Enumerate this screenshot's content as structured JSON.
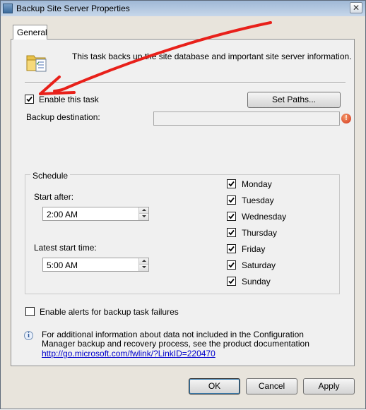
{
  "window": {
    "title": "Backup Site Server Properties",
    "close_glyph": "✕"
  },
  "tabs": [
    {
      "label": "General",
      "selected": true
    }
  ],
  "header": {
    "description": "This task backs up the site database and important site server information.",
    "icon": "folder-task-icon"
  },
  "enable_task": {
    "label": "Enable this task",
    "checked": true
  },
  "set_paths_button": {
    "label": "Set Paths..."
  },
  "backup_destination": {
    "label": "Backup destination:",
    "value": "",
    "error_icon": "error-icon",
    "error_glyph": "!"
  },
  "schedule": {
    "title": "Schedule",
    "start_after": {
      "label": "Start after:",
      "value": "2:00 AM"
    },
    "latest_start": {
      "label": "Latest start time:",
      "value": "5:00 AM"
    },
    "days": [
      {
        "label": "Monday",
        "checked": true
      },
      {
        "label": "Tuesday",
        "checked": true
      },
      {
        "label": "Wednesday",
        "checked": true
      },
      {
        "label": "Thursday",
        "checked": true
      },
      {
        "label": "Friday",
        "checked": true
      },
      {
        "label": "Saturday",
        "checked": true
      },
      {
        "label": "Sunday",
        "checked": true
      }
    ]
  },
  "alerts": {
    "label": "Enable alerts for backup task failures",
    "checked": false
  },
  "info": {
    "glyph": "i",
    "text": "For additional information about data not included in the Configuration Manager backup and recovery process, see the product documentation",
    "link": "http://go.microsoft.com/fwlink/?LinkID=220470"
  },
  "buttons": {
    "ok": "OK",
    "cancel": "Cancel",
    "apply": "Apply"
  },
  "colors": {
    "annotation_arrow": "#e8201a",
    "link": "#0000cc",
    "error": "#d2331a"
  }
}
